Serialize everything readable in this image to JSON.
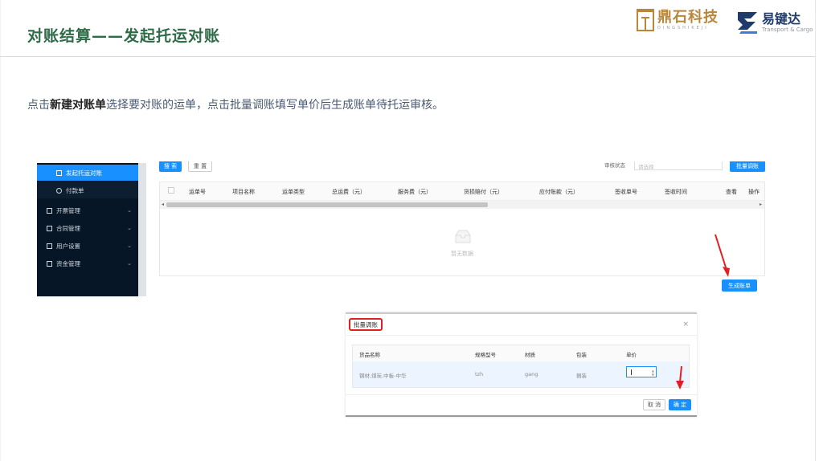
{
  "slide": {
    "title": "对账结算——发起托运对账",
    "instruction_pre": "点击",
    "instruction_bold": "新建对账单",
    "instruction_post": "选择要对账的运单，点击批量调账填写单价后生成账单待托运审核。"
  },
  "logos": {
    "dingshi": {
      "name": "鼎石科技",
      "sub": "DINGSHIKEJI"
    },
    "yijianda": {
      "name": "易键达",
      "sub": "Transport & Cargo"
    }
  },
  "sidebar": {
    "items": [
      {
        "label": "发起托运对账",
        "icon": "doc-icon",
        "active": true
      },
      {
        "label": "付款单",
        "icon": "circle-icon",
        "active": false
      },
      {
        "label": "开票管理",
        "icon": "invoice-icon",
        "chevron": "⌄"
      },
      {
        "label": "合同管理",
        "icon": "contract-icon",
        "chevron": "⌄"
      },
      {
        "label": "用户设置",
        "icon": "user-icon",
        "chevron": "⌄"
      },
      {
        "label": "资金管理",
        "icon": "wallet-icon",
        "chevron": "⌄"
      }
    ]
  },
  "toolbar": {
    "search_label": "搜 索",
    "reset_label": "重 置",
    "filter_label": "审核状态",
    "filter_placeholder": "请选择",
    "batch_label": "批量调账"
  },
  "table": {
    "columns": [
      "运单号",
      "项目名称",
      "运单类型",
      "总运费（元）",
      "服务费（元）",
      "货损赔付（元）",
      "应付账款（元）",
      "签收单号",
      "签收时间",
      "查看",
      "操作"
    ],
    "empty_text": "暂无数据"
  },
  "generate_button": "生成账单",
  "modal": {
    "title": "批量调账",
    "close": "×",
    "columns": [
      "货品名称",
      "规格型号",
      "材质",
      "包装",
      "单价"
    ],
    "row": {
      "name": "钢材,煤炭,中板-中华",
      "spec": "tzh",
      "material": "gang",
      "package": "捆装",
      "price": ""
    },
    "cancel_label": "取 消",
    "confirm_label": "确 定"
  },
  "colors": {
    "title_green": "#2e6b47",
    "primary": "#1890ff",
    "sidebar_bg": "#071626",
    "highlight_red": "#e02020"
  }
}
